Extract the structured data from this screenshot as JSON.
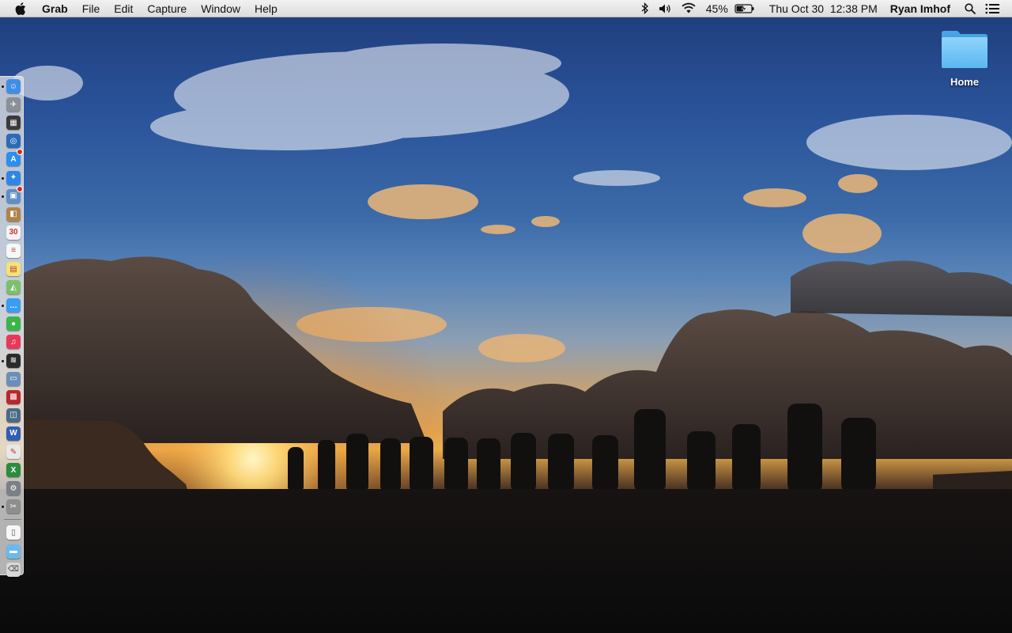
{
  "menubar": {
    "app_name": "Grab",
    "menus": [
      "File",
      "Edit",
      "Capture",
      "Window",
      "Help"
    ],
    "battery_percent": "45%",
    "datetime": "Thu Oct 30  12:38 PM",
    "user_name": "Ryan Imhof"
  },
  "desktop": {
    "icons": [
      {
        "label": "Home",
        "icon": "folder-icon"
      }
    ]
  },
  "dock": {
    "items": [
      {
        "name": "finder",
        "color": "#3e8ee8",
        "glyph": "☺",
        "running": true
      },
      {
        "name": "launchpad",
        "color": "#8a8f98",
        "glyph": "✈",
        "running": false
      },
      {
        "name": "mission-control",
        "color": "#3a3a3a",
        "glyph": "▦",
        "running": false
      },
      {
        "name": "quicktime",
        "color": "#2a6bb8",
        "glyph": "◎",
        "running": false
      },
      {
        "name": "app-store",
        "color": "#2b8ef0",
        "glyph": "A",
        "running": false,
        "badge": true
      },
      {
        "name": "safari",
        "color": "#2f86e6",
        "glyph": "✦",
        "running": true
      },
      {
        "name": "preview",
        "color": "#5d8fc8",
        "glyph": "▣",
        "running": true,
        "badge": true
      },
      {
        "name": "contacts",
        "color": "#b0834a",
        "glyph": "◧",
        "running": false
      },
      {
        "name": "calendar",
        "color": "#f4f4f4",
        "glyph": "30",
        "running": false
      },
      {
        "name": "reminders",
        "color": "#f7f7f7",
        "glyph": "≡",
        "running": false
      },
      {
        "name": "notes",
        "color": "#f3e27a",
        "glyph": "▤",
        "running": false
      },
      {
        "name": "maps",
        "color": "#7cc06b",
        "glyph": "◭",
        "running": false
      },
      {
        "name": "messages",
        "color": "#3a9cf2",
        "glyph": "…",
        "running": true
      },
      {
        "name": "facetime",
        "color": "#39b54a",
        "glyph": "●",
        "running": false
      },
      {
        "name": "itunes",
        "color": "#e8385a",
        "glyph": "♫",
        "running": false
      },
      {
        "name": "spotify",
        "color": "#2b2b2b",
        "glyph": "≋",
        "running": true
      },
      {
        "name": "photo-browser",
        "color": "#6b8fb8",
        "glyph": "▭",
        "running": false
      },
      {
        "name": "photo-booth",
        "color": "#b8282e",
        "glyph": "▩",
        "running": false
      },
      {
        "name": "image-capture",
        "color": "#4b6a88",
        "glyph": "◫",
        "running": false
      },
      {
        "name": "word",
        "color": "#2f5fb3",
        "glyph": "W",
        "running": false
      },
      {
        "name": "acrobat",
        "color": "#e8e8e8",
        "glyph": "✎",
        "running": false
      },
      {
        "name": "excel",
        "color": "#2a8c3f",
        "glyph": "X",
        "running": false
      },
      {
        "name": "system-preferences",
        "color": "#7b7f86",
        "glyph": "⚙",
        "running": false
      },
      {
        "name": "grab",
        "color": "#8e8e8e",
        "glyph": "✂",
        "running": true
      }
    ],
    "after_separator": [
      {
        "name": "documents-stack",
        "color": "#f7f7f7",
        "glyph": "▯"
      },
      {
        "name": "downloads-folder",
        "color": "#6cb8ec",
        "glyph": "▬"
      },
      {
        "name": "trash",
        "color": "#d8d8d8",
        "glyph": "⌫"
      }
    ]
  }
}
